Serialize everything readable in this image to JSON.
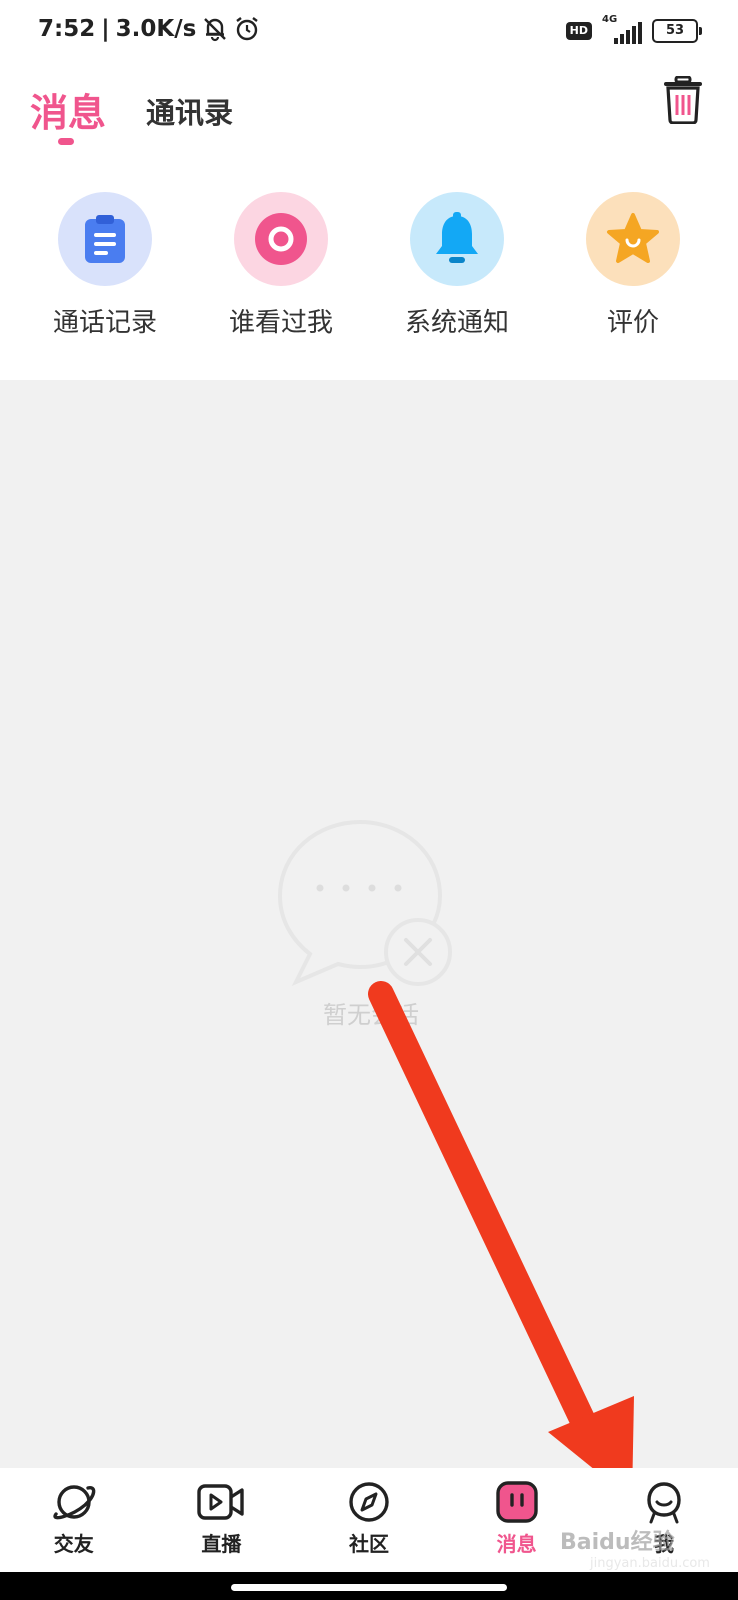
{
  "status_bar": {
    "time": "7:52",
    "speed": "3.0K/s",
    "hd": "HD",
    "network": "4G",
    "battery": "53"
  },
  "header": {
    "tab_active": "消息",
    "tab_inactive": "通讯录"
  },
  "quick_actions": [
    {
      "label": "通话记录",
      "icon": "clipboard-icon",
      "bg": "#d9e2fb",
      "color": "#4a7df0"
    },
    {
      "label": "谁看过我",
      "icon": "eye-ring-icon",
      "bg": "#fcd6e2",
      "color": "#f0558d"
    },
    {
      "label": "系统通知",
      "icon": "bell-icon",
      "bg": "#c7e9fb",
      "color": "#13a8f5"
    },
    {
      "label": "评价",
      "icon": "star-icon",
      "bg": "#fce0bb",
      "color": "#f5a623"
    }
  ],
  "empty_state": {
    "text": "暂无会话"
  },
  "bottom_nav": [
    {
      "label": "交友",
      "icon": "planet-icon"
    },
    {
      "label": "直播",
      "icon": "video-icon"
    },
    {
      "label": "社区",
      "icon": "compass-icon"
    },
    {
      "label": "消息",
      "icon": "message-icon",
      "active": true
    },
    {
      "label": "我",
      "icon": "person-icon"
    }
  ],
  "colors": {
    "accent": "#f0558d",
    "annotation_arrow": "#f03a1e"
  },
  "watermark": {
    "brand": "Baidu经验",
    "url": "jingyan.baidu.com"
  }
}
